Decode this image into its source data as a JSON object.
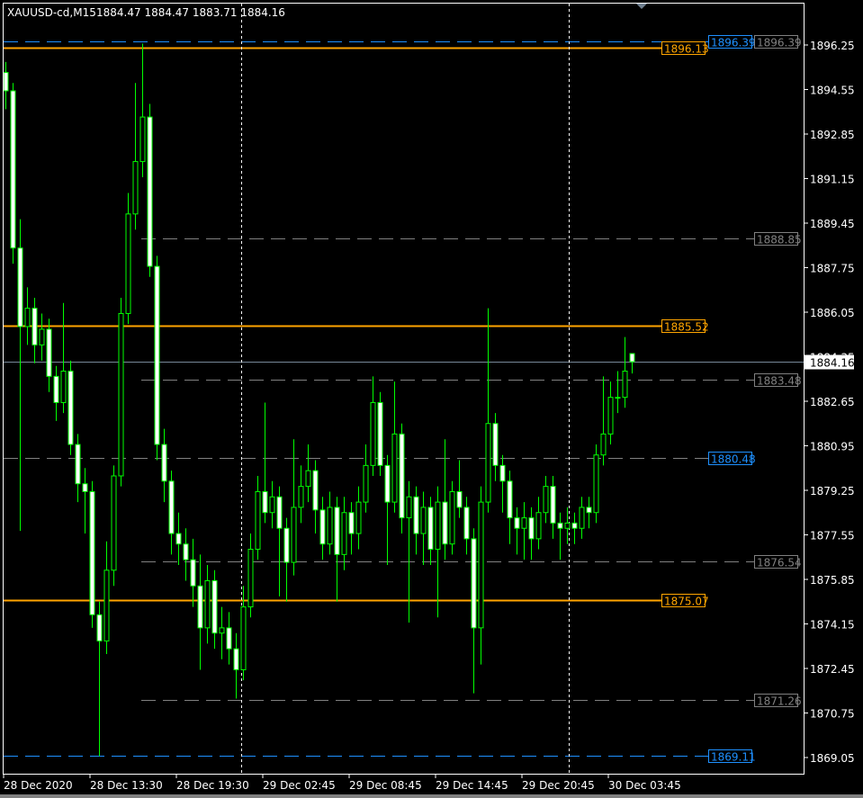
{
  "header": {
    "symbol": "XAUUSD-cd,M15",
    "ohlc": "1884.47 1884.47 1883.71 1884.16"
  },
  "colors": {
    "background": "#000000",
    "candle_outline": "#00ff00",
    "bull_fill": "#000000",
    "bear_fill": "#ffffff",
    "axis": "#ffffff",
    "orange_level": "#ffa500",
    "blue_level": "#1e90ff",
    "gray_level": "#808080",
    "bid_line": "#778899",
    "period_separator": "#ffffff"
  },
  "chart_data": {
    "type": "candlestick",
    "title": "XAUUSD-cd,M15",
    "ylim": [
      1868.6,
      1897.7
    ],
    "y_ticks": [
      "1896.25",
      "1894.55",
      "1892.85",
      "1891.15",
      "1889.45",
      "1887.75",
      "1886.05",
      "1884.35",
      "1882.65",
      "1880.95",
      "1879.25",
      "1877.55",
      "1875.85",
      "1874.15",
      "1872.45",
      "1870.75",
      "1869.05"
    ],
    "x_ticks": [
      "28 Dec 2020",
      "28 Dec 13:30",
      "28 Dec 19:30",
      "29 Dec 02:45",
      "29 Dec 08:45",
      "29 Dec 14:45",
      "29 Dec 20:45",
      "30 Dec 03:45"
    ],
    "grid": false,
    "current_price": "1884.16",
    "candles_ohlc": [
      [
        1895.2,
        1895.6,
        1893.8,
        1894.5
      ],
      [
        1894.5,
        1894.8,
        1887.9,
        1888.5
      ],
      [
        1888.5,
        1889.6,
        1877.7,
        1885.5
      ],
      [
        1885.5,
        1887.0,
        1884.8,
        1886.2
      ],
      [
        1886.2,
        1886.6,
        1884.1,
        1884.8
      ],
      [
        1884.8,
        1886.0,
        1884.2,
        1885.4
      ],
      [
        1885.4,
        1885.8,
        1883.0,
        1883.6
      ],
      [
        1883.6,
        1884.0,
        1881.9,
        1882.6
      ],
      [
        1882.6,
        1886.4,
        1882.2,
        1883.8
      ],
      [
        1883.8,
        1884.2,
        1880.6,
        1881.0
      ],
      [
        1881.0,
        1881.4,
        1878.8,
        1879.5
      ],
      [
        1879.5,
        1880.1,
        1877.6,
        1879.2
      ],
      [
        1879.2,
        1879.6,
        1874.0,
        1874.5
      ],
      [
        1874.5,
        1875.0,
        1869.1,
        1873.5
      ],
      [
        1873.5,
        1877.3,
        1873.0,
        1876.2
      ],
      [
        1876.2,
        1880.2,
        1875.6,
        1879.8
      ],
      [
        1879.8,
        1886.6,
        1879.4,
        1886.0
      ],
      [
        1886.0,
        1890.6,
        1885.6,
        1889.8
      ],
      [
        1889.8,
        1894.8,
        1889.2,
        1891.8
      ],
      [
        1891.8,
        1896.3,
        1891.2,
        1893.5
      ],
      [
        1893.5,
        1894.0,
        1887.4,
        1887.8
      ],
      [
        1887.8,
        1888.2,
        1880.4,
        1881.0
      ],
      [
        1881.0,
        1881.6,
        1878.8,
        1879.6
      ],
      [
        1879.6,
        1880.0,
        1876.8,
        1877.6
      ],
      [
        1877.6,
        1878.4,
        1876.4,
        1877.2
      ],
      [
        1877.2,
        1877.8,
        1875.8,
        1876.6
      ],
      [
        1876.6,
        1877.4,
        1874.8,
        1875.6
      ],
      [
        1875.6,
        1876.8,
        1872.4,
        1874.0
      ],
      [
        1874.0,
        1876.4,
        1873.4,
        1875.8
      ],
      [
        1875.8,
        1876.2,
        1873.2,
        1873.8
      ],
      [
        1873.8,
        1874.8,
        1872.8,
        1874.0
      ],
      [
        1874.0,
        1874.6,
        1872.6,
        1873.2
      ],
      [
        1873.2,
        1873.8,
        1871.3,
        1872.4
      ],
      [
        1872.4,
        1875.6,
        1872.0,
        1874.8
      ],
      [
        1874.8,
        1877.6,
        1874.4,
        1877.0
      ],
      [
        1877.0,
        1879.8,
        1876.6,
        1879.2
      ],
      [
        1879.2,
        1882.6,
        1878.0,
        1878.4
      ],
      [
        1878.4,
        1879.6,
        1877.8,
        1879.0
      ],
      [
        1879.0,
        1879.4,
        1875.2,
        1877.8
      ],
      [
        1877.8,
        1878.2,
        1875.0,
        1876.5
      ],
      [
        1876.5,
        1881.2,
        1876.0,
        1878.6
      ],
      [
        1878.6,
        1880.2,
        1878.0,
        1879.4
      ],
      [
        1879.4,
        1881.0,
        1878.8,
        1880.0
      ],
      [
        1880.0,
        1880.4,
        1877.6,
        1878.5
      ],
      [
        1878.5,
        1879.0,
        1876.6,
        1877.2
      ],
      [
        1877.2,
        1879.2,
        1876.8,
        1878.6
      ],
      [
        1878.6,
        1879.0,
        1875.0,
        1876.8
      ],
      [
        1876.8,
        1879.0,
        1876.2,
        1878.4
      ],
      [
        1878.4,
        1878.8,
        1876.8,
        1877.6
      ],
      [
        1877.6,
        1879.4,
        1877.0,
        1878.8
      ],
      [
        1878.8,
        1881.0,
        1878.4,
        1880.2
      ],
      [
        1880.2,
        1883.6,
        1879.8,
        1882.6
      ],
      [
        1882.6,
        1883.0,
        1879.8,
        1880.2
      ],
      [
        1880.2,
        1880.6,
        1876.4,
        1878.8
      ],
      [
        1878.8,
        1883.4,
        1878.4,
        1881.4
      ],
      [
        1881.4,
        1881.8,
        1877.6,
        1878.2
      ],
      [
        1878.2,
        1879.6,
        1874.2,
        1879.0
      ],
      [
        1879.0,
        1879.4,
        1876.8,
        1877.6
      ],
      [
        1877.6,
        1879.2,
        1876.4,
        1878.6
      ],
      [
        1878.6,
        1879.0,
        1876.4,
        1877.0
      ],
      [
        1877.0,
        1879.4,
        1874.4,
        1878.8
      ],
      [
        1878.8,
        1881.2,
        1876.6,
        1877.2
      ],
      [
        1877.2,
        1879.6,
        1876.8,
        1879.2
      ],
      [
        1879.2,
        1880.4,
        1878.2,
        1878.6
      ],
      [
        1878.6,
        1879.0,
        1876.8,
        1877.4
      ],
      [
        1877.4,
        1877.8,
        1871.5,
        1874.0
      ],
      [
        1874.0,
        1879.4,
        1872.6,
        1878.8
      ],
      [
        1878.8,
        1886.2,
        1878.4,
        1881.8
      ],
      [
        1881.8,
        1882.2,
        1879.6,
        1880.2
      ],
      [
        1880.2,
        1880.6,
        1878.4,
        1879.6
      ],
      [
        1879.6,
        1880.0,
        1877.2,
        1878.2
      ],
      [
        1878.2,
        1878.6,
        1876.8,
        1877.8
      ],
      [
        1877.8,
        1878.8,
        1876.6,
        1878.2
      ],
      [
        1878.2,
        1878.6,
        1876.6,
        1877.4
      ],
      [
        1877.4,
        1879.0,
        1877.0,
        1878.4
      ],
      [
        1878.4,
        1879.8,
        1878.0,
        1879.4
      ],
      [
        1879.4,
        1879.8,
        1877.4,
        1878.0
      ],
      [
        1878.0,
        1878.4,
        1876.6,
        1877.8
      ],
      [
        1877.8,
        1878.6,
        1877.2,
        1878.0
      ],
      [
        1878.0,
        1878.4,
        1877.2,
        1877.8
      ],
      [
        1877.8,
        1879.0,
        1877.4,
        1878.6
      ],
      [
        1878.6,
        1879.0,
        1877.8,
        1878.4
      ],
      [
        1878.4,
        1881.0,
        1878.0,
        1880.6
      ],
      [
        1880.6,
        1883.6,
        1880.2,
        1881.4
      ],
      [
        1881.4,
        1883.4,
        1881.0,
        1882.8
      ],
      [
        1882.8,
        1883.8,
        1882.2,
        1882.8
      ],
      [
        1882.8,
        1885.1,
        1882.4,
        1883.8
      ],
      [
        1884.47,
        1884.47,
        1883.71,
        1884.16
      ]
    ],
    "levels": [
      {
        "price": "1896.39",
        "style": "dashed",
        "color": "blue",
        "span": "full",
        "label_slot": "second"
      },
      {
        "price": "1896.39",
        "style": "label",
        "color": "gray",
        "span": "none",
        "label_slot": "third"
      },
      {
        "price": "1896.13",
        "style": "solid",
        "color": "orange",
        "span": "full",
        "label_slot": "first"
      },
      {
        "price": "1888.85",
        "style": "dashed",
        "color": "gray",
        "span": "partial",
        "label_slot": "third"
      },
      {
        "price": "1885.52",
        "style": "solid",
        "color": "orange",
        "span": "full",
        "label_slot": "first"
      },
      {
        "price": "1883.48",
        "style": "dashed",
        "color": "gray",
        "span": "partial",
        "label_slot": "third"
      },
      {
        "price": "1880.48",
        "style": "dashed",
        "color": "gray",
        "span": "full",
        "label_slot": "second",
        "label_color": "blue"
      },
      {
        "price": "1876.54",
        "style": "dashed",
        "color": "gray",
        "span": "partial",
        "label_slot": "third"
      },
      {
        "price": "1875.07",
        "style": "solid",
        "color": "orange",
        "span": "full",
        "label_slot": "first"
      },
      {
        "price": "1871.26",
        "style": "dashed",
        "color": "gray",
        "span": "partial",
        "label_slot": "third"
      },
      {
        "price": "1869.11",
        "style": "dashed",
        "color": "blue",
        "span": "full",
        "label_slot": "second"
      }
    ],
    "period_separators_at": [
      "28 Dec 2020 → 29 Dec",
      "29 Dec → 30 Dec"
    ]
  }
}
